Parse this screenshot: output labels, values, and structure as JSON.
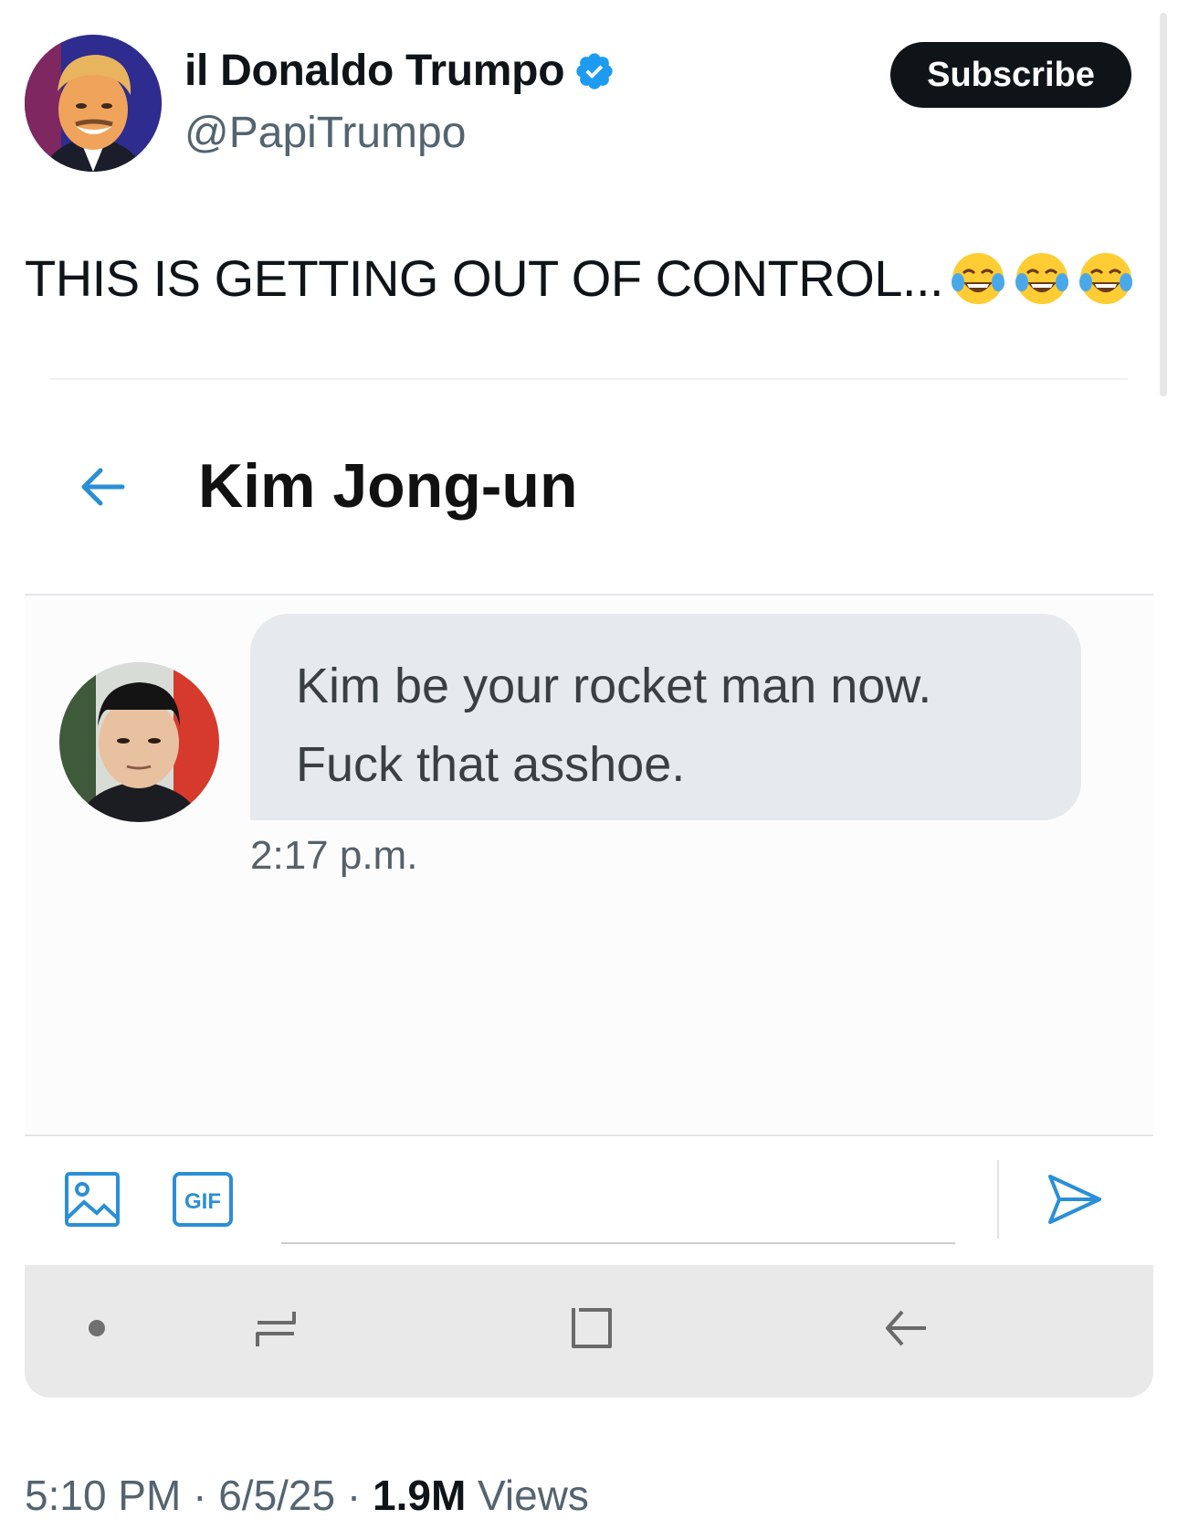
{
  "author": {
    "display_name": "il Donaldo Trumpo",
    "handle": "@PapiTrumpo",
    "verified": true
  },
  "subscribe_label": "Subscribe",
  "tweet": {
    "text": "THIS IS GETTING OUT OF CONTROL...",
    "emojis": [
      "face-with-tears-of-joy",
      "face-with-tears-of-joy",
      "face-with-tears-of-joy"
    ]
  },
  "screenshot": {
    "chat_title": "Kim Jong-un",
    "message_lines": [
      "Kim be your rocket man now.",
      "Fuck that asshoe."
    ],
    "message_time": "2:17 p.m.",
    "compose_icons": [
      "image-icon",
      "gif-icon",
      "send-icon"
    ],
    "gif_label": "GIF",
    "nav_icons": [
      "dot-icon",
      "recent-apps-icon",
      "home-icon",
      "back-icon"
    ]
  },
  "meta": {
    "time": "5:10 PM",
    "date": "6/5/25",
    "views_count": "1.9M",
    "views_label": "Views",
    "separator": "·"
  },
  "colors": {
    "accent_blue": "#1d9bf0",
    "chat_icon_blue": "#2a8fd6",
    "bubble_gray": "#e6e9ed",
    "nav_gray": "#e9e9e9"
  }
}
